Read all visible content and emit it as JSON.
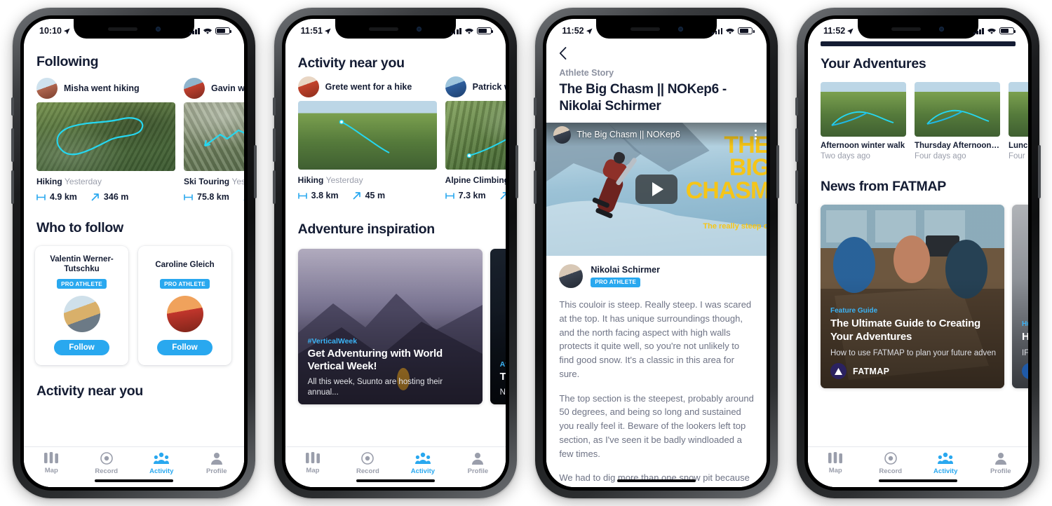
{
  "brand": {
    "accent": "#29a8ef",
    "ink": "#141c33",
    "muted": "#9a9eab"
  },
  "tabbar": {
    "items": [
      {
        "label": "Map",
        "icon": "map-icon",
        "active": false
      },
      {
        "label": "Record",
        "icon": "record-icon",
        "active": false
      },
      {
        "label": "Activity",
        "icon": "activity-people-icon",
        "active": true
      },
      {
        "label": "Profile",
        "icon": "profile-person-icon",
        "active": false
      }
    ]
  },
  "phone1": {
    "status": {
      "time": "10:10",
      "location_icon": "location-arrow-icon",
      "signal_icon": "cellular-bars-icon",
      "wifi_icon": "wifi-icon",
      "battery_icon": "battery-icon"
    },
    "following": {
      "title": "Following",
      "cards": [
        {
          "user": "Misha",
          "action": "went hiking",
          "activity_type": "Hiking",
          "when": "Yesterday",
          "distance": "4.9 km",
          "elevation": "346 m"
        },
        {
          "user": "Gavin",
          "action": "we",
          "activity_type": "Ski Touring",
          "when": "Yest",
          "distance": "75.8 km",
          "elevation": ""
        }
      ]
    },
    "who_to_follow": {
      "title": "Who to follow",
      "cards": [
        {
          "name": "Valentin Werner-Tutschku",
          "badge": "PRO ATHLETE",
          "button": "Follow"
        },
        {
          "name": "Caroline Gleich",
          "badge": "PRO ATHLETE",
          "button": "Follow"
        }
      ]
    },
    "next_section_title": "Activity near you"
  },
  "phone2": {
    "status": {
      "time": "11:51"
    },
    "near_you": {
      "title": "Activity near you",
      "cards": [
        {
          "user": "Grete",
          "action": "went for a hike",
          "activity_type": "Hiking",
          "when": "Yesterday",
          "distance": "3.8 km",
          "elevation": "45 m"
        },
        {
          "user": "Patrick",
          "action": "w",
          "activity_type": "Alpine Climbing",
          "when": "",
          "distance": "7.3 km",
          "elevation": ""
        }
      ]
    },
    "inspiration": {
      "title": "Adventure inspiration",
      "cards": [
        {
          "tag": "#VerticalWeek",
          "title": "Get Adventuring with World Vertical Week!",
          "subtitle": "All this week, Suunto are hosting their annual..."
        },
        {
          "tag": "At",
          "title": "T N",
          "subtitle": "Ni"
        }
      ]
    }
  },
  "phone3": {
    "status": {
      "time": "11:52"
    },
    "back_icon": "chevron-left-icon",
    "kicker": "Athlete Story",
    "title": "The Big Chasm || NOKep6 - Nikolai Schirmer",
    "video": {
      "title": "The Big Chasm || NOKep6",
      "play_icon": "play-button-icon",
      "menu_icon": "kebab-menu-icon",
      "overlay_lines": [
        "THE",
        "BIG",
        "CHASM"
      ],
      "overlay_sub": "The really steep o"
    },
    "author": {
      "name": "Nikolai Schirmer",
      "badge": "PRO ATHLETE"
    },
    "paragraphs": [
      "This couloir is steep. Really steep. I was scared at the top. It has unique surroundings though, and the north facing aspect with high walls protects it quite well, so you're not unlikely to find good snow. It's a classic in this area for sure.",
      "The top section is the steepest, probably around 50 degrees, and being so long and sustained you really feel it. Beware of the lookers left top section, as I've seen it be badly windloaded a few times.",
      "We had to dig more than one snow pit because of"
    ]
  },
  "phone4": {
    "status": {
      "time": "11:52"
    },
    "adventures": {
      "title": "Your Adventures",
      "cards": [
        {
          "title": "Afternoon winter walk",
          "date": "Two days ago"
        },
        {
          "title": "Thursday Afternoon R...",
          "date": "Four days ago"
        },
        {
          "title": "Lunc",
          "date": "Four"
        }
      ]
    },
    "news": {
      "title": "News from FATMAP",
      "cards": [
        {
          "tag": "Feature Guide",
          "title": "The Ultimate Guide to Creating Your Adventures",
          "subtitle": "How to use FATMAP to plan your future advent...",
          "brand": "FATMAP",
          "brand_icon": "fatmap-logo-icon"
        },
        {
          "tag": "Hu",
          "title": "H S",
          "subtitle": "IF",
          "brand": "",
          "brand_icon": "globe-icon"
        }
      ]
    }
  }
}
